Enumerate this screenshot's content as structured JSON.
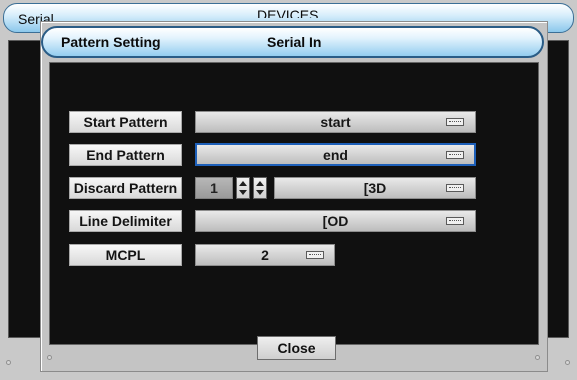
{
  "background": {
    "title_left": "Serial In",
    "title_center": "DEVICES"
  },
  "dialog": {
    "title": "Pattern Setting",
    "subtitle": "Serial In",
    "rows": [
      {
        "label": "Start Pattern",
        "value": "start"
      },
      {
        "label": "End Pattern",
        "value": "end"
      },
      {
        "label": "Discard Pattern",
        "count": "1",
        "value": "[3D"
      },
      {
        "label": "Line Delimiter",
        "value": "[OD"
      },
      {
        "label": "MCPL",
        "value": "2"
      }
    ],
    "close_label": "Close"
  },
  "colors": {
    "title_gradient_bottom": "#94cdef",
    "focus_border": "#1d5fb8",
    "body_dark": "#101010"
  },
  "icons": [
    "keyboard-icon",
    "spin-up-icon",
    "spin-down-icon"
  ]
}
